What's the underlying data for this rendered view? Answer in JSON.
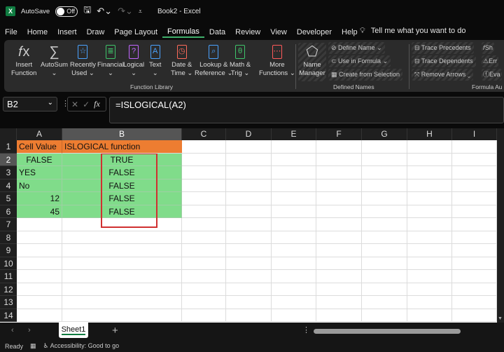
{
  "titlebar": {
    "autosave": "AutoSave",
    "toggle": "Off",
    "title": "Book2  -  Excel"
  },
  "tabs": [
    "File",
    "Home",
    "Insert",
    "Draw",
    "Page Layout",
    "Formulas",
    "Data",
    "Review",
    "View",
    "Developer",
    "Help"
  ],
  "active_tab": "Formulas",
  "tell_me": "Tell me what you want to do",
  "ribbon": {
    "function_library": {
      "label": "Function Library",
      "buttons": [
        {
          "l1": "Insert",
          "l2": "Function"
        },
        {
          "l1": "AutoSum",
          "l2": "⌄"
        },
        {
          "l1": "Recently",
          "l2": "Used ⌄"
        },
        {
          "l1": "Financial",
          "l2": "⌄"
        },
        {
          "l1": "Logical",
          "l2": "⌄"
        },
        {
          "l1": "Text",
          "l2": "⌄"
        },
        {
          "l1": "Date &",
          "l2": "Time ⌄"
        },
        {
          "l1": "Lookup &",
          "l2": "Reference ⌄"
        },
        {
          "l1": "Math &",
          "l2": "Trig ⌄"
        },
        {
          "l1": "More",
          "l2": "Functions ⌄"
        }
      ]
    },
    "defined_names": {
      "label": "Defined Names",
      "name_manager_1": "Name",
      "name_manager_2": "Manager",
      "define_name": "Define Name ⌄",
      "use_in_formula": "Use in Formula ⌄",
      "create_from_selection": "Create from Selection"
    },
    "formula_auditing": {
      "label": "Formula Au",
      "trace_precedents": "Trace Precedents",
      "trace_dependents": "Trace Dependents",
      "remove_arrows": "Remove Arrows ⌄",
      "show": "Sh",
      "error": "Err",
      "evaluate": "Eva"
    }
  },
  "formula_bar": {
    "name_box": "B2",
    "formula": "=ISLOGICAL(A2)"
  },
  "columns": [
    "A",
    "B",
    "C",
    "D",
    "E",
    "F",
    "G",
    "H",
    "I"
  ],
  "selected_column": "B",
  "rows": [
    "1",
    "2",
    "3",
    "4",
    "5",
    "6",
    "7",
    "8",
    "9",
    "10",
    "11",
    "12",
    "13",
    "14"
  ],
  "cells": {
    "A1": "Cell Value",
    "B1": "ISLOGICAL function",
    "A2": "FALSE",
    "B2": "TRUE",
    "A3": "YES",
    "B3": "FALSE",
    "A4": "No",
    "B4": "FALSE",
    "A5": "12",
    "B5": "FALSE",
    "A6": "45",
    "B6": "FALSE"
  },
  "colors": {
    "header_fill": "#ed7d31",
    "data_fill": "#80dc8a",
    "highlight_box": "#d03030"
  },
  "sheets": [
    "Sheet1"
  ],
  "status": {
    "ready": "Ready",
    "accessibility": "Accessibility: Good to go"
  }
}
